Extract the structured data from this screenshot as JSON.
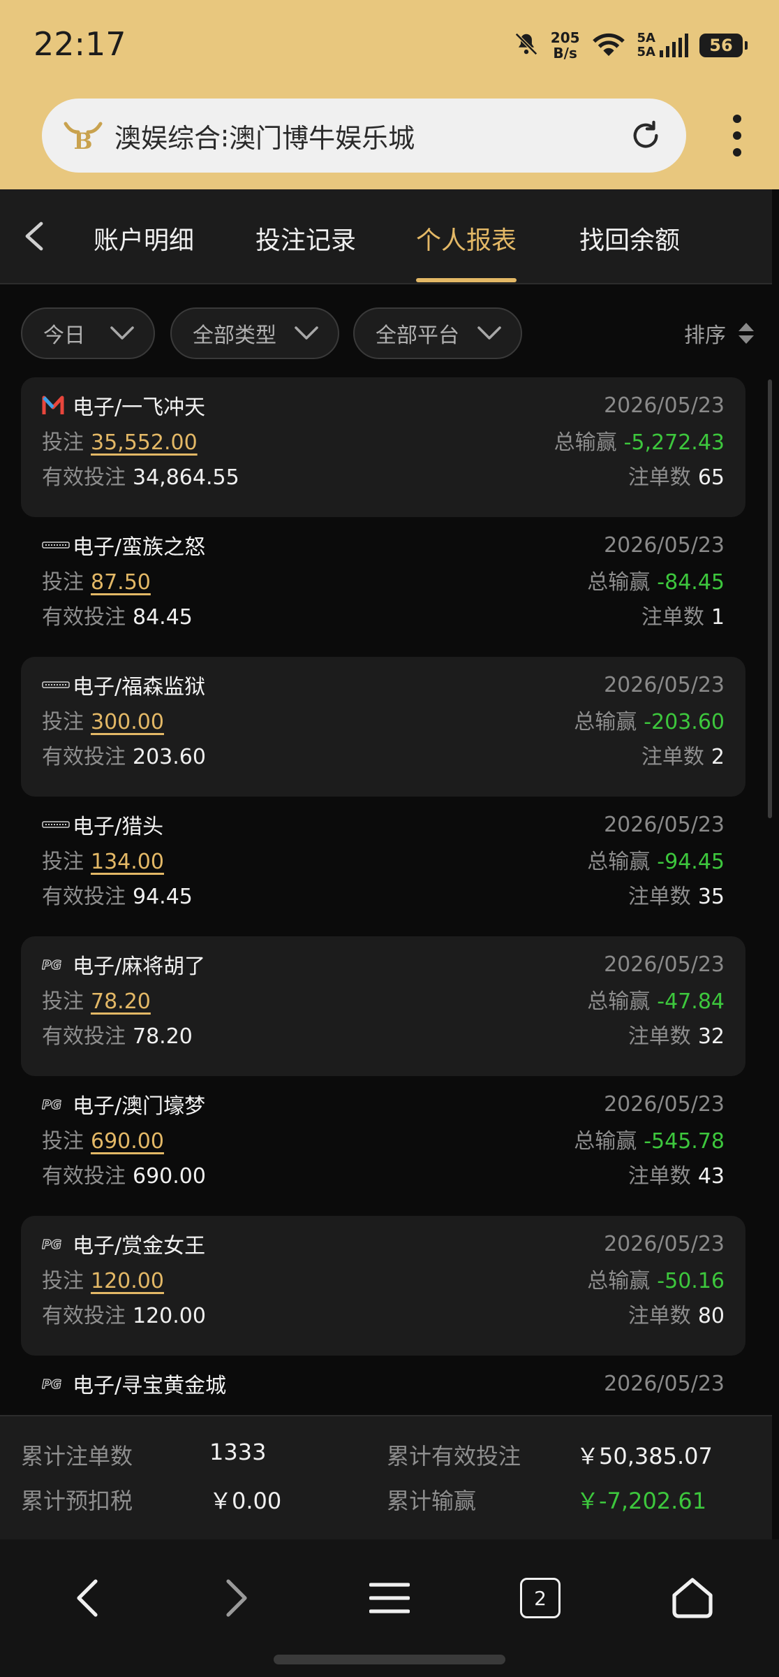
{
  "status_bar": {
    "time": "22:17",
    "net_speed_value": "205",
    "net_speed_unit": "B/s",
    "signal_label_1": "5A",
    "signal_label_2": "5A",
    "battery": "56"
  },
  "browser": {
    "address_text": "澳娱综合⁝澳门博牛娱乐城",
    "logo_letter": "B"
  },
  "tabs": [
    {
      "label": "账户明细"
    },
    {
      "label": "投注记录"
    },
    {
      "label": "个人报表",
      "active": true
    },
    {
      "label": "找回余额"
    }
  ],
  "filters": {
    "date": "今日",
    "type": "全部类型",
    "platform": "全部平台",
    "sort": "排序"
  },
  "labels": {
    "bet": "投注",
    "valid_bet": "有效投注",
    "total_win": "总输赢",
    "order_count": "注单数"
  },
  "records": [
    {
      "provider_icon": "m-provider-icon",
      "game": "电子/一飞冲天",
      "date": "2026/05/23",
      "bet": "35,552.00",
      "win": "-5,272.43",
      "valid": "34,864.55",
      "count": "65"
    },
    {
      "provider_icon": "generic-provider-icon",
      "game": "电子/蛮族之怒",
      "date": "2026/05/23",
      "bet": "87.50",
      "win": "-84.45",
      "valid": "84.45",
      "count": "1"
    },
    {
      "provider_icon": "generic-provider-icon",
      "game": "电子/福森监狱",
      "date": "2026/05/23",
      "bet": "300.00",
      "win": "-203.60",
      "valid": "203.60",
      "count": "2"
    },
    {
      "provider_icon": "generic-provider-icon",
      "game": "电子/猎头",
      "date": "2026/05/23",
      "bet": "134.00",
      "win": "-94.45",
      "valid": "94.45",
      "count": "35"
    },
    {
      "provider_icon": "pg-provider-icon",
      "game": "电子/麻将胡了",
      "date": "2026/05/23",
      "bet": "78.20",
      "win": "-47.84",
      "valid": "78.20",
      "count": "32"
    },
    {
      "provider_icon": "pg-provider-icon",
      "game": "电子/澳门壕梦",
      "date": "2026/05/23",
      "bet": "690.00",
      "win": "-545.78",
      "valid": "690.00",
      "count": "43"
    },
    {
      "provider_icon": "pg-provider-icon",
      "game": "电子/赏金女王",
      "date": "2026/05/23",
      "bet": "120.00",
      "win": "-50.16",
      "valid": "120.00",
      "count": "80"
    },
    {
      "provider_icon": "pg-provider-icon",
      "game": "电子/寻宝黄金城",
      "date": "2026/05/23",
      "bet": "",
      "win": "",
      "valid": "",
      "count": ""
    }
  ],
  "totals": {
    "order_count_label": "累计注单数",
    "order_count": "1333",
    "valid_bet_label": "累计有效投注",
    "valid_bet": "￥50,385.07",
    "tax_label": "累计预扣税",
    "tax": "￥0.00",
    "win_label": "累计输赢",
    "win": "￥-7,202.61"
  },
  "bottom_nav": {
    "tab_count": "2"
  },
  "colors": {
    "accent_gold": "#e3b866",
    "chrome_bg": "#e8c77e",
    "win_green": "#3dc73d"
  }
}
